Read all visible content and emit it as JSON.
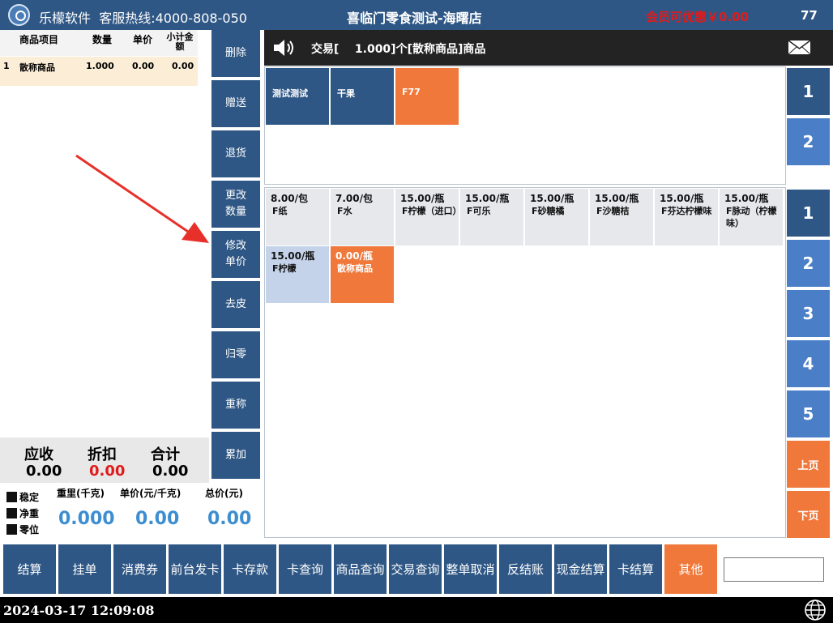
{
  "titlebar": {
    "brand": "乐檬软件",
    "hotline": "客服热线:4000-808-050",
    "store": "喜临门零食测试-海曙店",
    "promo": "会员可优惠￥0.00",
    "count": "77"
  },
  "itemlist": {
    "columns": [
      "商品项目",
      "数量",
      "单价",
      "小计金额"
    ],
    "rows": [
      {
        "index": "1",
        "name": "散称商品",
        "qty": "1.000",
        "price": "0.00",
        "subtotal": "0.00"
      }
    ]
  },
  "functions": [
    "删除",
    "赠送",
    "退货",
    "更改\n数量",
    "修改\n单价",
    "去皮",
    "归零",
    "重称",
    "累加"
  ],
  "totals": {
    "receivable_label": "应收",
    "receivable": "0.00",
    "discount_label": "折扣",
    "discount": "0.00",
    "total_label": "合计",
    "total": "0.00",
    "discount_color": "#e01b1b"
  },
  "scale": {
    "flags": [
      "稳定",
      "净重",
      "零位"
    ],
    "weight_label": "重里(千克)",
    "weight": "0.000",
    "unit_price_label": "单价(元/千克)",
    "unit_price": "0.00",
    "total_price_label": "总价(元)",
    "total_price": "0.00"
  },
  "banner": {
    "message": "交易[    1.000]个[散称商品]商品"
  },
  "categories": [
    {
      "label": "测试测试",
      "color": "#2f5785"
    },
    {
      "label": "干果",
      "color": "#2f5785"
    },
    {
      "label": "F77",
      "color": "#f0783a"
    }
  ],
  "category_pages": [
    "1",
    "2"
  ],
  "products": [
    {
      "price": "8.00/包",
      "name": "F纸",
      "bg": "#e6e8ec",
      "fg": "#111111"
    },
    {
      "price": "7.00/包",
      "name": "F水",
      "bg": "#e6e8ec",
      "fg": "#111111"
    },
    {
      "price": "15.00/瓶",
      "name": "F柠檬（进口）",
      "bg": "#e6e8ec",
      "fg": "#111111"
    },
    {
      "price": "15.00/瓶",
      "name": "F可乐",
      "bg": "#e6e8ec",
      "fg": "#111111"
    },
    {
      "price": "15.00/瓶",
      "name": "F砂糖橘",
      "bg": "#e6e8ec",
      "fg": "#111111"
    },
    {
      "price": "15.00/瓶",
      "name": "F沙糖桔",
      "bg": "#e6e8ec",
      "fg": "#111111"
    },
    {
      "price": "15.00/瓶",
      "name": "F芬达柠檬味",
      "bg": "#e6e8ec",
      "fg": "#111111"
    },
    {
      "price": "15.00/瓶",
      "name": "F脉动（柠檬味）",
      "bg": "#e6e8ec",
      "fg": "#111111"
    },
    {
      "price": "15.00/瓶",
      "name": "F柠檬",
      "bg": "#c5d3ea",
      "fg": "#111111"
    },
    {
      "price": "0.00/瓶",
      "name": "散称商品",
      "bg": "#f0783a",
      "fg": "#ffffff"
    }
  ],
  "product_pages": [
    "1",
    "2",
    "3",
    "4",
    "5"
  ],
  "paging": {
    "prev": "上页",
    "next": "下页"
  },
  "bottom_buttons": [
    {
      "label": "结算",
      "color": "#2f5785"
    },
    {
      "label": "挂单",
      "color": "#2f5785"
    },
    {
      "label": "消费券",
      "color": "#2f5785"
    },
    {
      "label": "前台发卡",
      "color": "#2f5785"
    },
    {
      "label": "卡存款",
      "color": "#2f5785"
    },
    {
      "label": "卡查询",
      "color": "#2f5785"
    },
    {
      "label": "商品查询",
      "color": "#2f5785"
    },
    {
      "label": "交易查询",
      "color": "#2f5785"
    },
    {
      "label": "整单取消",
      "color": "#2f5785"
    },
    {
      "label": "反结账",
      "color": "#2f5785"
    },
    {
      "label": "现金结算",
      "color": "#2f5785"
    },
    {
      "label": "卡结算",
      "color": "#2f5785"
    },
    {
      "label": "其他",
      "color": "#f0783a"
    }
  ],
  "input": {
    "value": ""
  },
  "status": {
    "datetime": "2024-03-17 12:09:08"
  },
  "annotation": {
    "color": "#e8302a"
  }
}
